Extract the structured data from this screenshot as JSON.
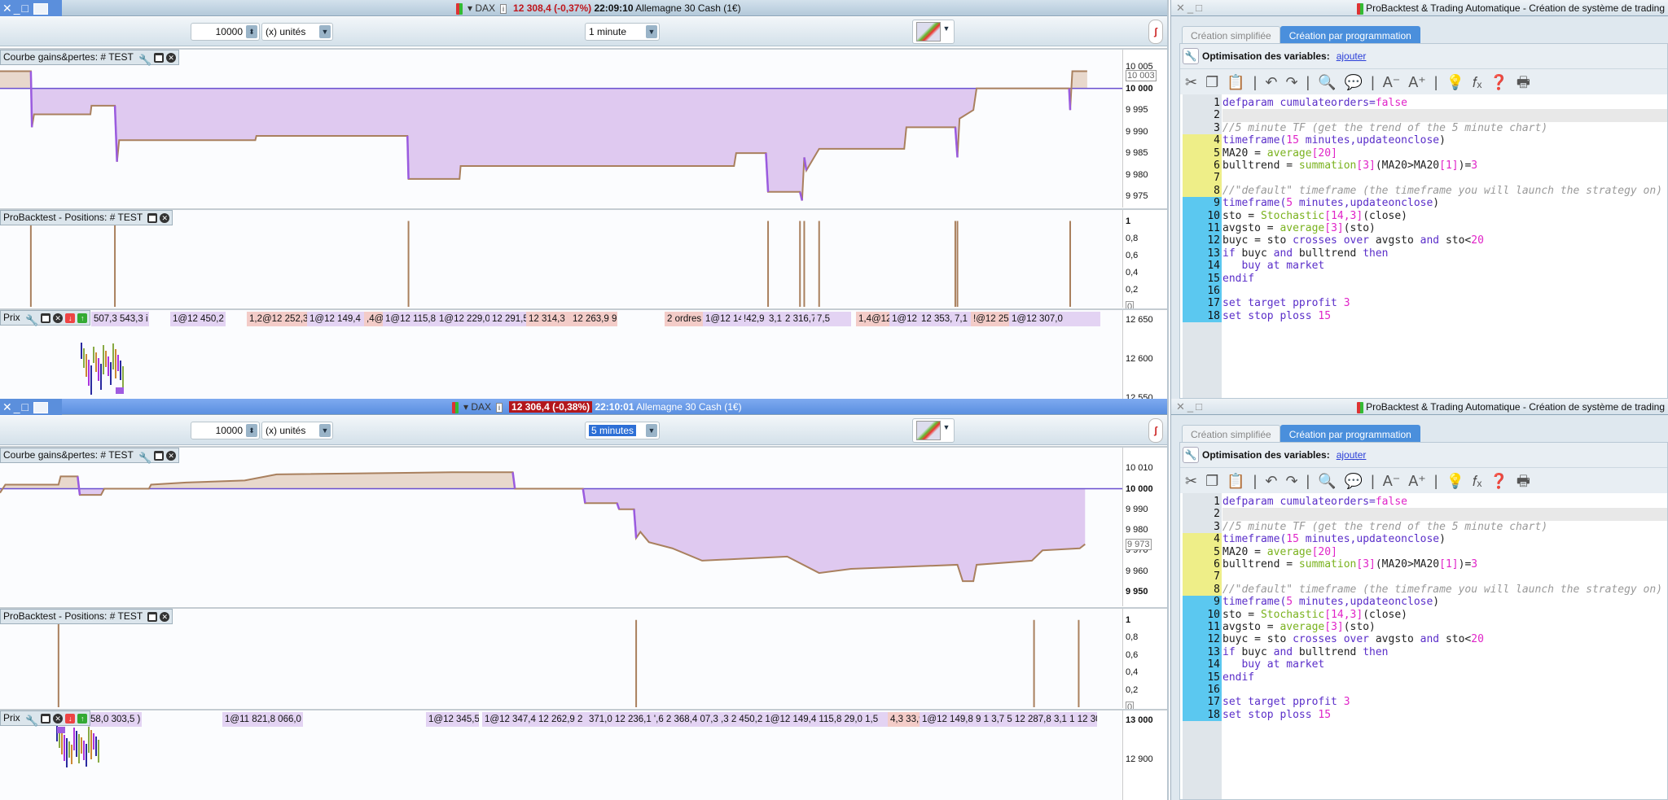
{
  "windows": [
    {
      "title": {
        "symbol": "DAX",
        "price": "12 308,4 (-0,37%)",
        "time": "22:09:10",
        "instrument": "Allemagne 30 Cash (1€)"
      },
      "toolbar": {
        "quantity": "10000",
        "unit": "(x) unités",
        "timeframe": "1 minute"
      },
      "equity_header": "Courbe gains&pertes: # TEST",
      "positions_header": "ProBacktest - Positions: # TEST",
      "price_header": "Prix",
      "price_ticks": [
        "12 650",
        "12 600",
        "12 550"
      ],
      "tags": [
        {
          "text": "507,3  543,3 i",
          "side": "buy"
        },
        {
          "text": "1@12 450,2",
          "side": "buy"
        },
        {
          "text": "1,2@12 252,3",
          "side": "sell"
        },
        {
          "text": "1@12 149,4",
          "side": "buy"
        },
        {
          "text": ",4@",
          "side": "sell"
        },
        {
          "text": "1@12 115,8",
          "side": "buy"
        },
        {
          "text": "1@12 229,0",
          "side": "buy"
        },
        {
          "text": "12 291,5",
          "side": "buy"
        },
        {
          "text": "12 314,3",
          "side": "sell"
        },
        {
          "text": "12 263,9 9",
          "side": "sell"
        },
        {
          "text": "2 ordres",
          "side": "sell"
        },
        {
          "text": "1@12 149,8",
          "side": "buy"
        },
        {
          "text": "!42,9",
          "side": "buy"
        },
        {
          "text": "3,1",
          "side": "buy"
        },
        {
          "text": "2 316,7",
          "side": "buy"
        },
        {
          "text": "7,5",
          "side": "buy"
        },
        {
          "text": "1,4@12",
          "side": "sell"
        },
        {
          "text": "1@12 287,8",
          "side": "buy"
        },
        {
          "text": "12 353,1",
          "side": "buy"
        },
        {
          "text": "7,1",
          "side": "buy"
        },
        {
          "text": "!@12 259,",
          "side": "sell"
        },
        {
          "text": "1@12 307,0",
          "side": "buy"
        }
      ]
    },
    {
      "title": {
        "symbol": "DAX",
        "price": "12 306,4 (-0,38%)",
        "time": "22:10:01",
        "instrument": "Allemagne 30 Cash (1€)"
      },
      "toolbar": {
        "quantity": "10000",
        "unit": "(x) unités",
        "timeframe": "5 minutes"
      },
      "equity_header": "Courbe gains&pertes: # TEST",
      "positions_header": "ProBacktest - Positions: # TEST",
      "price_header": "Prix",
      "price_ticks": [
        "13 000",
        "12 900"
      ],
      "tags": [
        {
          "text": "58,0 303,5 ) 693,2",
          "side": "buy"
        },
        {
          "text": "1@11 821,8 066,0",
          "side": "buy"
        },
        {
          "text": "1@12 345,5",
          "side": "buy"
        },
        {
          "text": "1@12 347,4  12 262,9 2",
          "side": "buy"
        },
        {
          "text": "371,0 12 236,1 ',6  2 368,4 07,3 ,3 2 450,2  1@12 149,4  115,8 29,0 1,5",
          "side": "buy"
        },
        {
          "text": "4,3 33,9",
          "side": "sell"
        },
        {
          "text": "1@12 149,8  9 1 3,7  5 12 287,8  3,1 1  12 307,0",
          "side": "buy"
        }
      ]
    }
  ],
  "editor": {
    "title": "ProBacktest & Trading Automatique - Création de système de trading",
    "tabs": [
      "Création simplifiée",
      "Création par programmation"
    ],
    "optimisation_label": "Optimisation des variables:",
    "optimisation_link": "ajouter",
    "toolbar_icons": [
      "cut-icon",
      "copy-icon",
      "paste-icon",
      "undo-icon",
      "redo-icon",
      "search-icon",
      "comment-icon",
      "font-decrease-icon",
      "font-increase-icon",
      "lightbulb-icon",
      "function-icon",
      "help-icon",
      "print-icon"
    ],
    "lines": [
      [
        [
          "defparam cumulateorders=",
          "kw"
        ],
        [
          "false",
          "nm"
        ]
      ],
      [],
      [
        [
          "//5 minute TF (get the trend of the 5 minute chart)",
          "cm"
        ]
      ],
      [
        [
          "timeframe(",
          "kw"
        ],
        [
          "15",
          "nm"
        ],
        [
          " minutes,updateonclose",
          "kw"
        ],
        [
          ")",
          "pl"
        ]
      ],
      [
        [
          "MA20 = ",
          "pl"
        ],
        [
          "average",
          "fn"
        ],
        [
          "[20]",
          "nm"
        ]
      ],
      [
        [
          "bulltrend = ",
          "pl"
        ],
        [
          "summation",
          "fn"
        ],
        [
          "[3]",
          "nm"
        ],
        [
          "(MA20>MA20",
          "pl"
        ],
        [
          "[1]",
          "nm"
        ],
        [
          ")=",
          "pl"
        ],
        [
          "3",
          "nm"
        ]
      ],
      [],
      [
        [
          "//\"default\" timeframe (the timeframe you will launch the strategy on)",
          "cm"
        ]
      ],
      [
        [
          "timeframe(",
          "kw"
        ],
        [
          "5",
          "nm"
        ],
        [
          " minutes,updateonclose",
          "kw"
        ],
        [
          ")",
          "pl"
        ]
      ],
      [
        [
          "sto = ",
          "pl"
        ],
        [
          "Stochastic",
          "fn"
        ],
        [
          "[14,3]",
          "nm"
        ],
        [
          "(close)",
          "pl"
        ]
      ],
      [
        [
          "avgsto = ",
          "pl"
        ],
        [
          "average",
          "fn"
        ],
        [
          "[3]",
          "nm"
        ],
        [
          "(sto)",
          "pl"
        ]
      ],
      [
        [
          "buyc = sto ",
          "pl"
        ],
        [
          "crosses over",
          "kw"
        ],
        [
          " avgsto ",
          "pl"
        ],
        [
          "and",
          "kw"
        ],
        [
          " sto<",
          "pl"
        ],
        [
          "20",
          "nm"
        ]
      ],
      [
        [
          "if",
          "kw"
        ],
        [
          " buyc ",
          "pl"
        ],
        [
          "and",
          "kw"
        ],
        [
          " bulltrend ",
          "pl"
        ],
        [
          "then",
          "kw"
        ]
      ],
      [
        [
          "   buy at market",
          "kw"
        ]
      ],
      [
        [
          "endif",
          "kw"
        ]
      ],
      [],
      [
        [
          "set target pprofit ",
          "kw"
        ],
        [
          "3",
          "nm"
        ]
      ],
      [
        [
          "set stop ploss ",
          "kw"
        ],
        [
          "15",
          "nm"
        ]
      ]
    ]
  },
  "chart_data": [
    {
      "type": "line",
      "title": "Courbe gains&pertes: # TEST (1 minute)",
      "baseline": 10000,
      "ylim": [
        9972,
        10009
      ],
      "yticks": [
        {
          "v": 10005,
          "l": "10 005"
        },
        {
          "v": 10000,
          "l": "10 000",
          "bold": true
        },
        {
          "v": 9995,
          "l": "9 995"
        },
        {
          "v": 9990,
          "l": "9 990"
        },
        {
          "v": 9985,
          "l": "9 985"
        },
        {
          "v": 9980,
          "l": "9 980"
        },
        {
          "v": 9975,
          "l": "9 975"
        }
      ],
      "current": {
        "v": 10003,
        "l": "10 003"
      },
      "xmax": 1055,
      "points": [
        [
          0,
          10004
        ],
        [
          29,
          10004
        ],
        [
          30,
          9991
        ],
        [
          32,
          9994
        ],
        [
          85,
          9994
        ],
        [
          86,
          9996
        ],
        [
          108,
          9996
        ],
        [
          110,
          9983
        ],
        [
          112,
          9988
        ],
        [
          240,
          9988
        ],
        [
          241,
          9989
        ],
        [
          383,
          9989
        ],
        [
          384,
          9979
        ],
        [
          432,
          9979
        ],
        [
          433,
          9982
        ],
        [
          690,
          9982
        ],
        [
          692,
          9985
        ],
        [
          720,
          9985
        ],
        [
          722,
          9976
        ],
        [
          752,
          9976
        ],
        [
          754,
          9974
        ],
        [
          756,
          9984
        ],
        [
          758,
          9981
        ],
        [
          770,
          9986
        ],
        [
          850,
          9986
        ],
        [
          852,
          9991
        ],
        [
          898,
          9991
        ],
        [
          900,
          9984
        ],
        [
          902,
          9993
        ],
        [
          915,
          9995
        ],
        [
          918,
          10000
        ],
        [
          1005,
          10000
        ],
        [
          1006,
          9995
        ],
        [
          1008,
          10004
        ],
        [
          1022,
          10004
        ]
      ]
    },
    {
      "type": "bar",
      "title": "ProBacktest - Positions: # TEST (1 minute)",
      "ylim": [
        0,
        1.1
      ],
      "yticks": [
        {
          "v": 1,
          "l": "1",
          "bold": true
        },
        {
          "v": 0.8,
          "l": "0,8"
        },
        {
          "v": 0.6,
          "l": "0,6"
        },
        {
          "v": 0.4,
          "l": "0,4"
        },
        {
          "v": 0.2,
          "l": "0,2"
        }
      ],
      "current": {
        "v": 0,
        "l": "0"
      },
      "xmax": 1055,
      "x": [
        29,
        108,
        384,
        722,
        752,
        756,
        770,
        898,
        900,
        1006
      ],
      "values": [
        1,
        1,
        1,
        1,
        1,
        1,
        1,
        1,
        1,
        1
      ]
    },
    {
      "type": "line",
      "title": "Courbe gains&pertes: # TEST (5 minutes)",
      "baseline": 10000,
      "ylim": [
        9942,
        10020
      ],
      "yticks": [
        {
          "v": 10010,
          "l": "10 010"
        },
        {
          "v": 10000,
          "l": "10 000",
          "bold": true
        },
        {
          "v": 9990,
          "l": "9 990"
        },
        {
          "v": 9980,
          "l": "9 980"
        },
        {
          "v": 9970,
          "l": "9 970"
        },
        {
          "v": 9960,
          "l": "9 960"
        },
        {
          "v": 9950,
          "l": "9 950",
          "bold": true
        }
      ],
      "current": {
        "v": 9973,
        "l": "9 973"
      },
      "xmax": 1055,
      "points": [
        [
          0,
          9998
        ],
        [
          5,
          10002
        ],
        [
          55,
          10002
        ],
        [
          57,
          10006
        ],
        [
          73,
          10006
        ],
        [
          75,
          9997
        ],
        [
          95,
          9997
        ],
        [
          98,
          10000
        ],
        [
          140,
          10000
        ],
        [
          142,
          10002
        ],
        [
          175,
          10003
        ],
        [
          230,
          10004
        ],
        [
          260,
          10007
        ],
        [
          425,
          10008
        ],
        [
          482,
          10008
        ],
        [
          484,
          10000
        ],
        [
          548,
          10000
        ],
        [
          550,
          9993
        ],
        [
          580,
          9993
        ],
        [
          582,
          9990
        ],
        [
          596,
          9990
        ],
        [
          598,
          9976
        ],
        [
          602,
          9979
        ],
        [
          610,
          9974
        ],
        [
          632,
          9971
        ],
        [
          660,
          9965
        ],
        [
          700,
          9966
        ],
        [
          740,
          9967
        ],
        [
          770,
          9959
        ],
        [
          800,
          9961
        ],
        [
          900,
          9963
        ],
        [
          905,
          9955
        ],
        [
          915,
          9955
        ],
        [
          918,
          9963
        ],
        [
          970,
          9965
        ],
        [
          980,
          9970
        ],
        [
          1015,
          9971
        ],
        [
          1020,
          9973
        ]
      ]
    },
    {
      "type": "bar",
      "title": "ProBacktest - Positions: # TEST (5 minutes)",
      "ylim": [
        0,
        1.1
      ],
      "yticks": [
        {
          "v": 1,
          "l": "1",
          "bold": true
        },
        {
          "v": 0.8,
          "l": "0,8"
        },
        {
          "v": 0.6,
          "l": "0,6"
        },
        {
          "v": 0.4,
          "l": "0,4"
        },
        {
          "v": 0.2,
          "l": "0,2"
        }
      ],
      "current": {
        "v": 0,
        "l": "0"
      },
      "xmax": 1055,
      "x": [
        55,
        598,
        972,
        1014
      ],
      "values": [
        1,
        1,
        1,
        1
      ]
    }
  ]
}
